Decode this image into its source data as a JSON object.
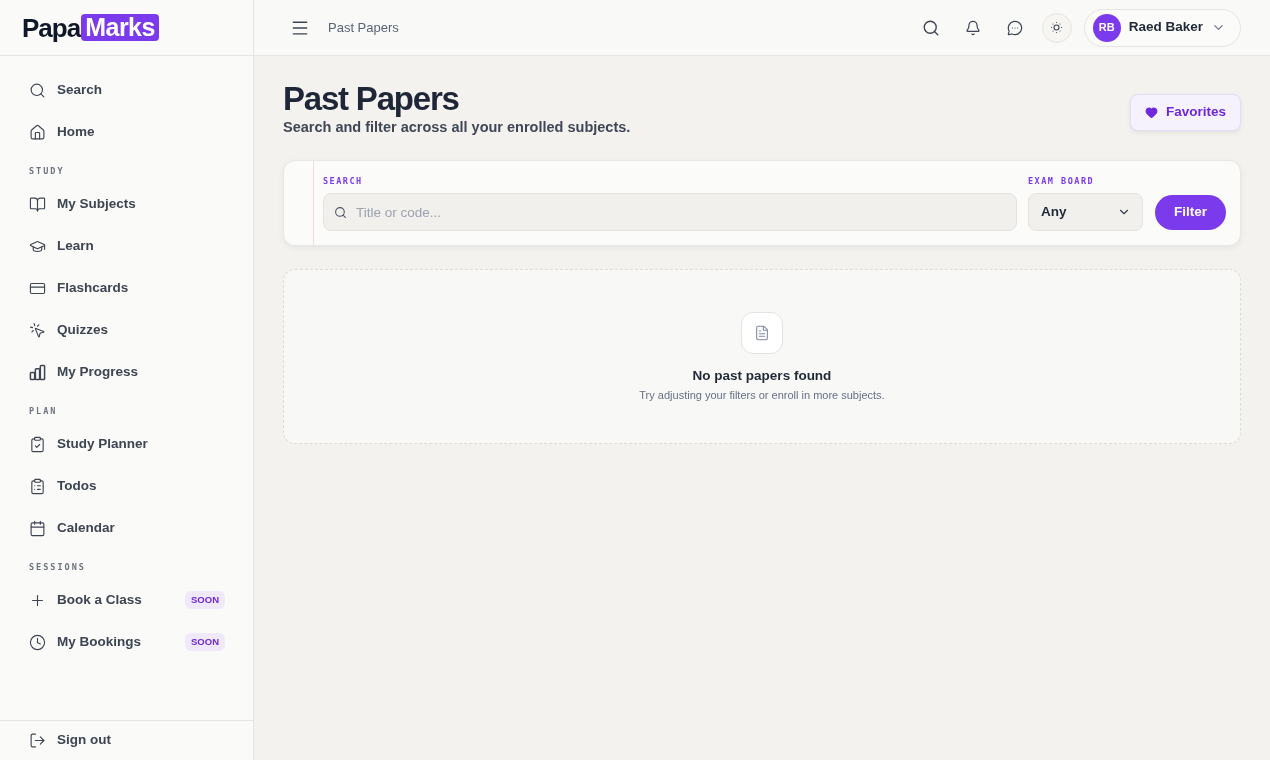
{
  "logo": {
    "text_1": "Papa",
    "text_2": "Marks"
  },
  "sidebar": {
    "sections": [
      {
        "items": [
          {
            "label": "Search"
          },
          {
            "label": "Home"
          }
        ]
      },
      {
        "title": "STUDY",
        "items": [
          {
            "label": "My Subjects"
          },
          {
            "label": "Learn"
          },
          {
            "label": "Flashcards"
          },
          {
            "label": "Quizzes"
          },
          {
            "label": "My Progress"
          }
        ]
      },
      {
        "title": "PLAN",
        "items": [
          {
            "label": "Study Planner"
          },
          {
            "label": "Todos"
          },
          {
            "label": "Calendar"
          }
        ]
      },
      {
        "title": "SESSIONS",
        "items": [
          {
            "label": "Book a Class",
            "badge": "SOON"
          },
          {
            "label": "My Bookings",
            "badge": "SOON"
          }
        ]
      }
    ],
    "footer": {
      "label": "Sign out"
    }
  },
  "header": {
    "breadcrumb": "Past Papers",
    "user": {
      "initials": "RB",
      "name": "Raed Baker"
    }
  },
  "page": {
    "title": "Past Papers",
    "subtitle": "Search and filter across all your enrolled subjects.",
    "favorites_button": "Favorites"
  },
  "filters": {
    "search": {
      "label": "SEARCH",
      "placeholder": "Title or code..."
    },
    "exam_board": {
      "label": "EXAM BOARD",
      "value": "Any"
    },
    "filter_button": "Filter"
  },
  "empty_state": {
    "title": "No past papers found",
    "message": "Try adjusting your filters or enroll in more subjects."
  }
}
